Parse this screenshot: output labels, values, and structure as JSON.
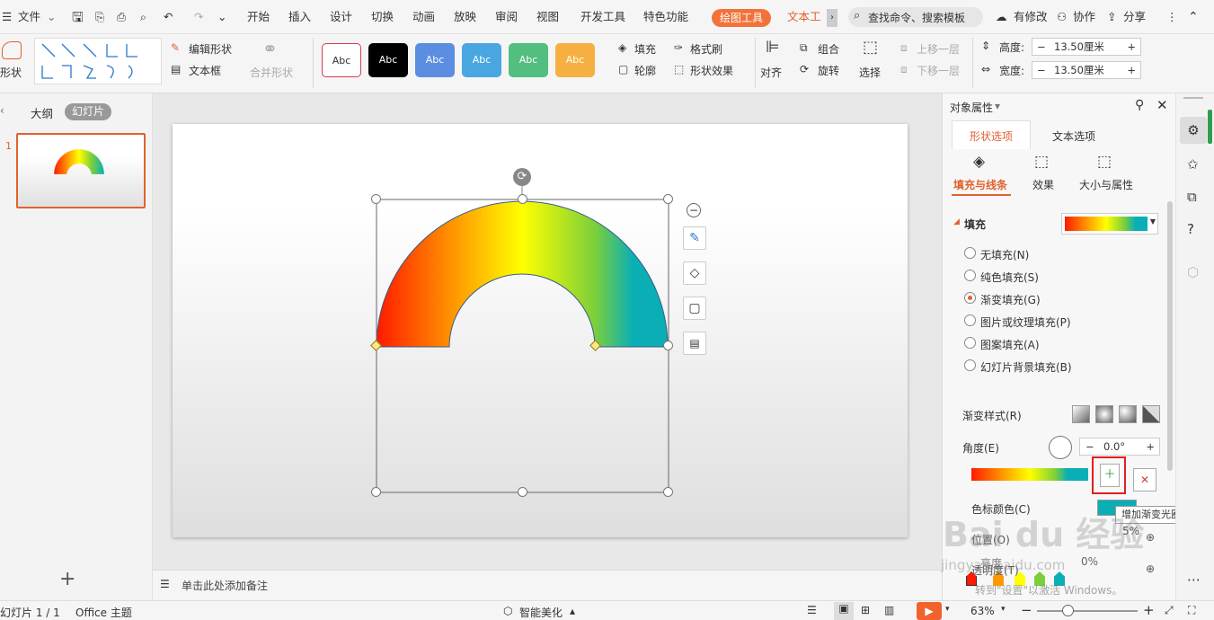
{
  "titlebar": {
    "menu_file": "文件",
    "tabs": [
      "开始",
      "插入",
      "设计",
      "切换",
      "动画",
      "放映",
      "审阅",
      "视图",
      "开发工具",
      "特色功能"
    ],
    "active_tab": "绘图工具",
    "tab_text_tools": "文本工具",
    "search_placeholder": "查找命令、搜索模板",
    "has_changes": "有修改",
    "collab": "协作",
    "share": "分享"
  },
  "ribbon": {
    "shape": "形状",
    "edit_shape": "编辑形状",
    "text_box": "文本框",
    "merge_shape": "合并形状",
    "style_samples": [
      "Abc",
      "Abc",
      "Abc",
      "Abc",
      "Abc",
      "Abc"
    ],
    "fill": "填充",
    "format_brush": "格式刷",
    "outline": "轮廓",
    "shape_effect": "形状效果",
    "align": "对齐",
    "group": "组合",
    "rotate": "旋转",
    "select": "选择",
    "bring_forward": "上移一层",
    "send_backward": "下移一层",
    "height_label": "高度:",
    "height_value": "13.50厘米",
    "width_label": "宽度:",
    "width_value": "13.50厘米"
  },
  "left_panel": {
    "tab_outline": "大纲",
    "tab_slides": "幻灯片",
    "slide_number": "1",
    "add": "+"
  },
  "notes_placeholder": "单击此处添加备注",
  "pane": {
    "title": "对象属性",
    "tab_shape": "形状选项",
    "tab_text": "文本选项",
    "sub_fill": "填充与线条",
    "sub_effect": "效果",
    "sub_size": "大小与属性",
    "fill_section": "填充",
    "options": [
      "无填充(N)",
      "纯色填充(S)",
      "渐变填充(G)",
      "图片或纹理填充(P)",
      "图案填充(A)",
      "幻灯片背景填充(B)"
    ],
    "selected_option": "渐变填充(G)",
    "gradient_style": "渐变样式(R)",
    "angle_label": "角度(E)",
    "angle_value": "0.0°",
    "color_stop_label": "色标颜色(C)",
    "position_label": "位置(O)",
    "position_value": "5%",
    "brightness_label": "亮度",
    "transparency_label": "透明度(T)",
    "transparency_value": "0%",
    "tooltip": "增加渐变光圈",
    "watermark_lines": [
      "Bai du 经验",
      "jingyan.baidu.com",
      "转到\"设置\"以激活 Windows。"
    ]
  },
  "status": {
    "slide_info": "幻灯片 1 / 1",
    "theme": "Office 主题",
    "beautify": "智能美化",
    "zoom": "63%"
  },
  "colors": {
    "accent": "#e0622d",
    "gradient": [
      "#ff1a00",
      "#ff9900",
      "#ffff00",
      "#7ccf3a",
      "#0aafb5"
    ]
  }
}
